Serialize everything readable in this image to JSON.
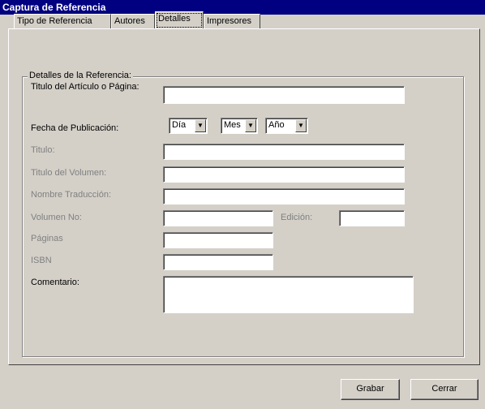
{
  "window": {
    "title": "Captura de Referencia"
  },
  "tabs": [
    {
      "label": "Tipo de Referencia"
    },
    {
      "label": "Autores"
    },
    {
      "label": "Detalles"
    },
    {
      "label": "Impresores"
    }
  ],
  "group": {
    "title": "Detalles de la Referencia:"
  },
  "fields": {
    "titulo_articulo": {
      "label": "Titulo del Artículo o Página:",
      "value": ""
    },
    "fecha": {
      "label": "Fecha de Publicación:",
      "dia": "Día",
      "mes": "Mes",
      "anio": "Año",
      "dropdown_icon": "chevron-down-icon"
    },
    "titulo": {
      "label": "Titulo:",
      "value": ""
    },
    "titulo_volumen": {
      "label": "Titulo del Volumen:",
      "value": ""
    },
    "nombre_traduccion": {
      "label": "Nombre Traducción:",
      "value": ""
    },
    "volumen_no": {
      "label": "Volumen No:",
      "value": ""
    },
    "edicion": {
      "label": "Edición:",
      "value": ""
    },
    "paginas": {
      "label": "Páginas",
      "value": ""
    },
    "isbn": {
      "label": "ISBN",
      "value": ""
    },
    "comentario": {
      "label": "Comentario:",
      "value": ""
    }
  },
  "buttons": {
    "grabar": "Grabar",
    "cerrar": "Cerrar"
  }
}
